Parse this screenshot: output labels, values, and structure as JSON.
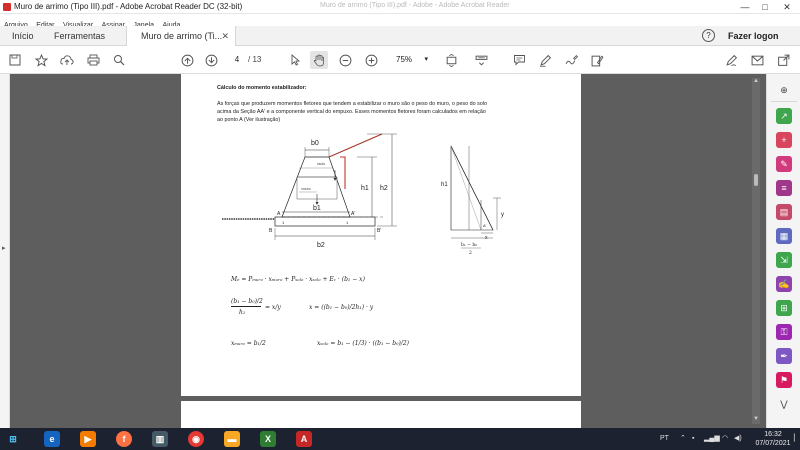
{
  "window": {
    "title": "Muro de arrimo (Tipo III).pdf - Adobe Acrobat Reader DC (32-bit)",
    "center_title": "Muro de arrimo (Tipo III).pdf - Adobe - Adobe Acrobat Reader",
    "minimize": "—",
    "maximize": "□",
    "close": "✕"
  },
  "menu": [
    "Arquivo",
    "Editar",
    "Visualizar",
    "Assinar",
    "Janela",
    "Ajuda"
  ],
  "tabs": {
    "home": "Início",
    "tools": "Ferramentas",
    "document": "Muro de arrimo (Ti...",
    "close": "✕",
    "help": "?",
    "login": "Fazer logon"
  },
  "toolbar": {
    "page_current": "4",
    "page_total": "/ 13",
    "zoom": "75%"
  },
  "document": {
    "heading": "Cálculo do momento estabilizador:",
    "paragraph": [
      "As forças que produzem momentos fletores que tendem a estabilizar o muro são o peso do muro, o peso do solo",
      "acima da Seção AA' e a componente vertical do empuxo. Esses momentos fletores foram calculados em relação",
      "ao ponto A (Ver ilustração)"
    ],
    "fig1": {
      "b0": "b0",
      "b1": "b1",
      "b2": "b2",
      "h1": "h1",
      "h2": "h2",
      "solo": "xsolo",
      "muro": "xmuro",
      "A": "A",
      "A2": "A'",
      "B": "B",
      "B2": "B'",
      "one_left": "1",
      "one_right": "1"
    },
    "fig2": {
      "h1": "h1",
      "y": "y",
      "x": "x",
      "A2": "A'",
      "frac_num": "b₁ − b₀",
      "frac_den": "2"
    },
    "formulas": {
      "moment": "Mₑ = Pₘᵤᵣₒ · xₘᵤᵣₒ + Pₛₒₗₒ · xₛₒₗₒ + Eᵥ · (b₁ − x)",
      "ratio_num": "(b₁ − b₀)/2",
      "ratio_den": "h₁",
      "ratio_rhs": "= x/y",
      "x_eq": "x = ((b₁ − b₀)/2h₁) · y",
      "xmuro": "xₘᵤᵣₒ = b₁/2",
      "xsolo": "xₛₒₗₒ = b₁ − (1/3) · ((b₁ − b₀)/2)"
    }
  },
  "taskbar": {
    "lang": "PT",
    "time": "16:32",
    "date": "07/07/2021"
  },
  "colors": {
    "titlebar": "#ffffff",
    "tabbar": "#f2f2f2",
    "content_bg": "#5e5e5e",
    "taskbar": "#1c2230",
    "accent_red": "#d32f2f",
    "dimension_red": "#c0392b"
  }
}
